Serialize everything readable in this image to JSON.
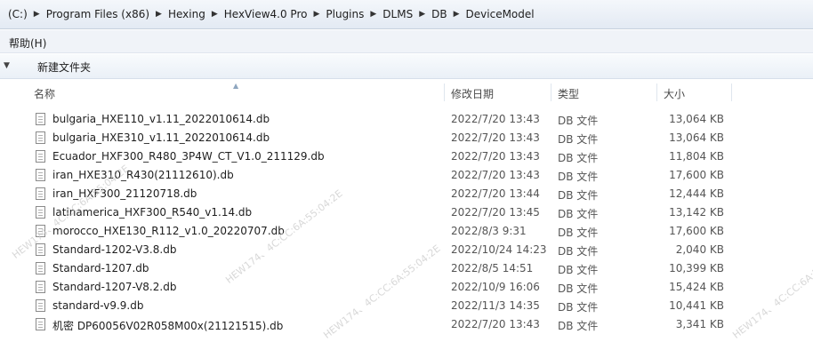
{
  "breadcrumb": [
    "(C:)",
    "Program Files (x86)",
    "Hexing",
    "HexView4.0 Pro",
    "Plugins",
    "DLMS",
    "DB",
    "DeviceModel"
  ],
  "menu": {
    "help": "帮助(H)"
  },
  "toolbar": {
    "new_folder": "新建文件夹"
  },
  "columns": {
    "name": "名称",
    "date": "修改日期",
    "type": "类型",
    "size": "大小"
  },
  "files": [
    {
      "name": "bulgaria_HXE110_v1.11_2022010614.db",
      "date": "2022/7/20 13:43",
      "type": "DB 文件",
      "size": "13,064 KB"
    },
    {
      "name": "bulgaria_HXE310_v1.11_2022010614.db",
      "date": "2022/7/20 13:43",
      "type": "DB 文件",
      "size": "13,064 KB"
    },
    {
      "name": "Ecuador_HXF300_R480_3P4W_CT_V1.0_211129.db",
      "date": "2022/7/20 13:43",
      "type": "DB 文件",
      "size": "11,804 KB"
    },
    {
      "name": "iran_HXE310_R430(21112610).db",
      "date": "2022/7/20 13:43",
      "type": "DB 文件",
      "size": "17,600 KB"
    },
    {
      "name": "iran_HXF300_21120718.db",
      "date": "2022/7/20 13:44",
      "type": "DB 文件",
      "size": "12,444 KB"
    },
    {
      "name": "latinamerica_HXF300_R540_v1.14.db",
      "date": "2022/7/20 13:45",
      "type": "DB 文件",
      "size": "13,142 KB"
    },
    {
      "name": "morocco_HXE130_R112_v1.0_20220707.db",
      "date": "2022/8/3 9:31",
      "type": "DB 文件",
      "size": "17,600 KB"
    },
    {
      "name": "Standard-1202-V3.8.db",
      "date": "2022/10/24 14:23",
      "type": "DB 文件",
      "size": "2,040 KB"
    },
    {
      "name": "Standard-1207.db",
      "date": "2022/8/5 14:51",
      "type": "DB 文件",
      "size": "10,399 KB"
    },
    {
      "name": "Standard-1207-V8.2.db",
      "date": "2022/10/9 16:06",
      "type": "DB 文件",
      "size": "15,424 KB"
    },
    {
      "name": "standard-v9.9.db",
      "date": "2022/11/3 14:35",
      "type": "DB 文件",
      "size": "10,441 KB"
    },
    {
      "name": "机密 DP60056V02R058M00x(21121515).db",
      "date": "2022/7/20 13:43",
      "type": "DB 文件",
      "size": "3,341 KB"
    }
  ],
  "watermark": "HEW174、4C:CC:6A:55:04:2E"
}
